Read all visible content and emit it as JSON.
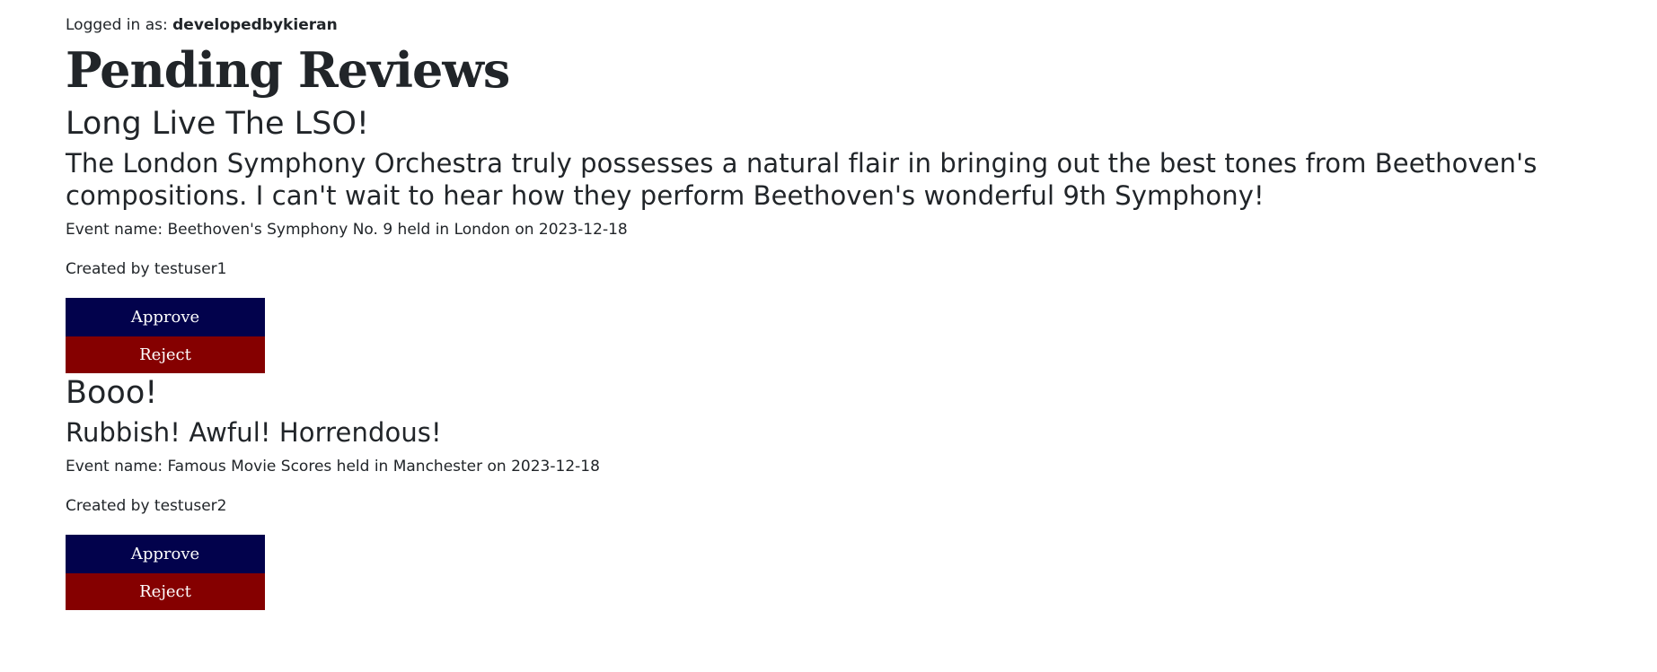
{
  "header": {
    "logged_in_label": "Logged in as: ",
    "username": "developedbykieran"
  },
  "page": {
    "title": "Pending Reviews"
  },
  "reviews": [
    {
      "title": "Long Live The LSO!",
      "body": "The London Symphony Orchestra truly possesses a natural flair in bringing out the best tones from Beethoven's compositions. I can't wait to hear how they perform Beethoven's wonderful 9th Symphony!",
      "event": "Event name: Beethoven's Symphony No. 9 held in London on 2023-12-18",
      "created_by": "Created by testuser1",
      "approve_label": "Approve",
      "reject_label": "Reject"
    },
    {
      "title": "Booo!",
      "body": "Rubbish! Awful! Horrendous!",
      "event": "Event name: Famous Movie Scores held in Manchester on 2023-12-18",
      "created_by": "Created by testuser2",
      "approve_label": "Approve",
      "reject_label": "Reject"
    }
  ],
  "colors": {
    "approve": "#02024c",
    "reject": "#850000",
    "text": "#212529",
    "background": "#ffffff"
  }
}
